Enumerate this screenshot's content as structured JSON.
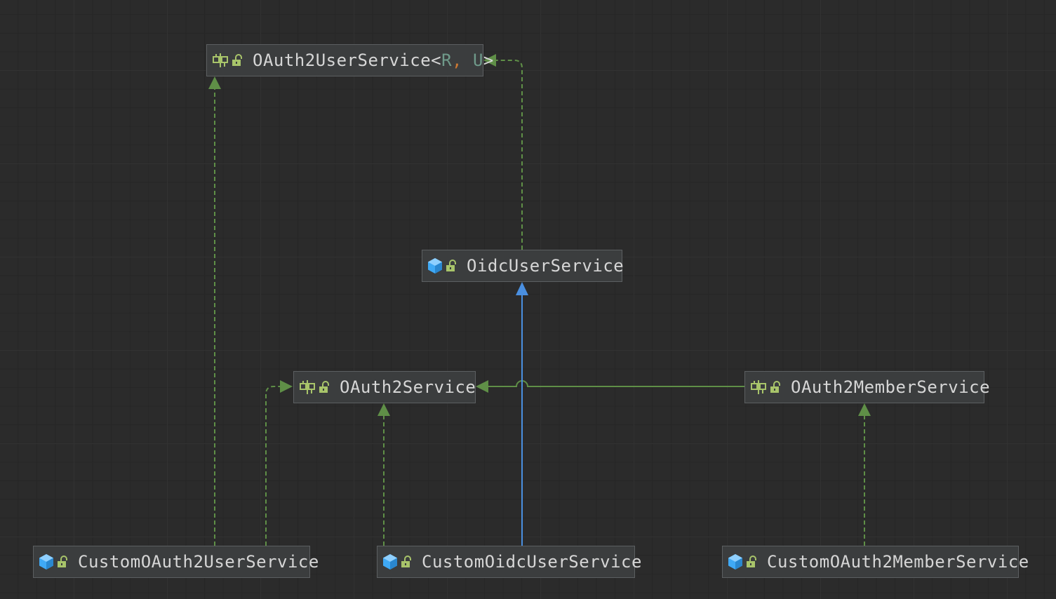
{
  "colors": {
    "background": "#2b2b2b",
    "node_fill": "#3b3d3e",
    "node_border": "#5c5f61",
    "node_text": "#d6d6d6",
    "type_param": "#6f9a8a",
    "implements_edge": "#5f8f47",
    "extends_edge": "#4a8fe0",
    "interface_icon": "#a8c46a",
    "class_icon": "#3fa9f5",
    "unlocked_icon": "#a8c46a"
  },
  "nodes": {
    "oauth2_user_service": {
      "name": "OAuth2UserService",
      "lt": "<",
      "param_r": "R",
      "sep": ",",
      "param_u": " U",
      "gt": ">",
      "kind_icon": "interface-icon",
      "access_icon": "public-unlocked-icon"
    },
    "oidc_user_service": {
      "name": "OidcUserService",
      "kind_icon": "class-icon",
      "access_icon": "public-unlocked-icon"
    },
    "oauth2_service": {
      "name": "OAuth2Service",
      "kind_icon": "interface-icon",
      "access_icon": "public-unlocked-icon"
    },
    "oauth2_member_service": {
      "name": "OAuth2MemberService",
      "kind_icon": "interface-icon",
      "access_icon": "public-unlocked-icon"
    },
    "custom_oauth2_user_service": {
      "name": "CustomOAuth2UserService",
      "kind_icon": "class-icon",
      "access_icon": "public-unlocked-icon"
    },
    "custom_oidc_user_service": {
      "name": "CustomOidcUserService",
      "kind_icon": "class-icon",
      "access_icon": "public-unlocked-icon"
    },
    "custom_oauth2_member_service": {
      "name": "CustomOAuth2MemberService",
      "kind_icon": "class-icon",
      "access_icon": "public-unlocked-icon"
    }
  },
  "edges": [
    {
      "from": "CustomOAuth2UserService",
      "to": "OAuth2UserService",
      "relation": "implements"
    },
    {
      "from": "CustomOAuth2UserService",
      "to": "OAuth2Service",
      "relation": "implements"
    },
    {
      "from": "OidcUserService",
      "to": "OAuth2UserService",
      "relation": "implements"
    },
    {
      "from": "CustomOidcUserService",
      "to": "OAuth2Service",
      "relation": "implements"
    },
    {
      "from": "CustomOidcUserService",
      "to": "OidcUserService",
      "relation": "extends"
    },
    {
      "from": "OAuth2MemberService",
      "to": "OAuth2Service",
      "relation": "extends"
    },
    {
      "from": "CustomOAuth2MemberService",
      "to": "OAuth2MemberService",
      "relation": "implements"
    }
  ]
}
